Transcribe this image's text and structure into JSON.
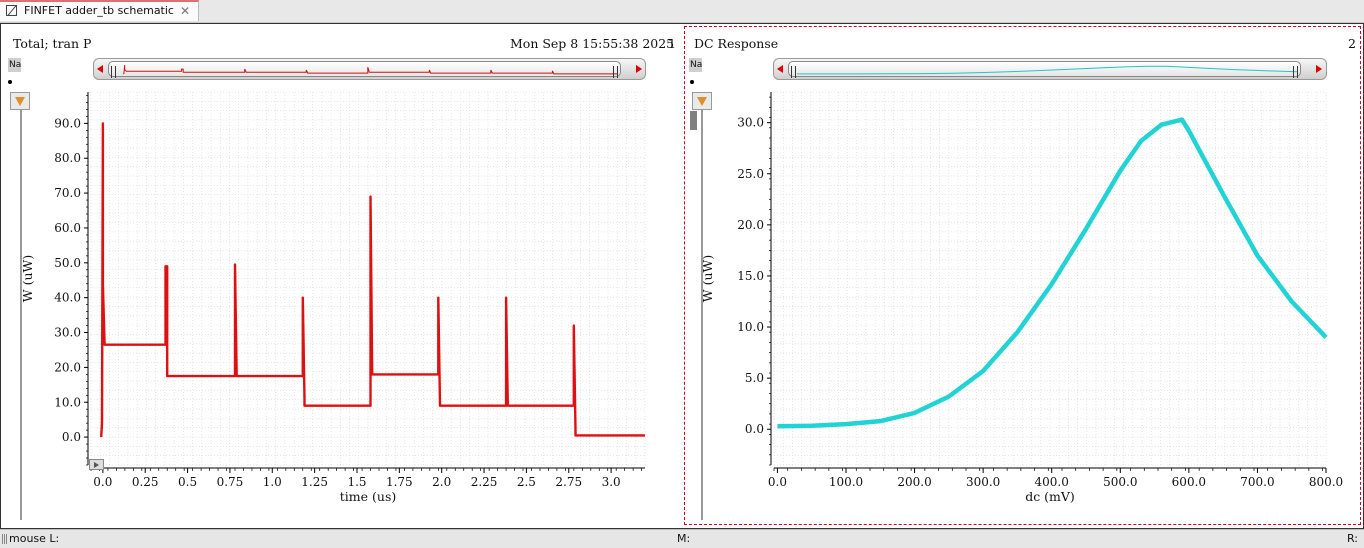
{
  "tab": {
    "label": "FINFET adder_tb schematic",
    "close": "✕"
  },
  "left_pane": {
    "title": "Total; tran P",
    "timestamp": "Mon Sep 8 15:55:38 2025",
    "index": "1",
    "name_stub": "Na",
    "trace_color": "#dd1111"
  },
  "right_pane": {
    "title": "DC Response",
    "index": "2",
    "name_stub": "Na",
    "trace_color": "#22d3d6",
    "selected_border_color": "#cc0022"
  },
  "status": {
    "mouse_l": "mouse L:",
    "m": "M:",
    "r": "R:"
  },
  "chart_data": [
    {
      "type": "line",
      "xlabel": "time (us)",
      "ylabel": "W (uW)",
      "xlim": [
        -0.07,
        3.2
      ],
      "ylim": [
        -8,
        99
      ],
      "x_ticks": [
        "0.0",
        "0.25",
        "0.5",
        "0.75",
        "1.0",
        "1.25",
        "1.5",
        "1.75",
        "2.0",
        "2.25",
        "2.5",
        "2.75",
        "3.0"
      ],
      "y_ticks": [
        "0.0",
        "10.0",
        "20.0",
        "30.0",
        "40.0",
        "50.0",
        "60.0",
        "70.0",
        "80.0",
        "90.0"
      ],
      "grid": true,
      "series": [
        {
          "color": "#dd1111",
          "x": [
            -0.01,
            -0.005,
            0.0,
            0.0,
            0.01,
            0.01,
            0.37,
            0.37,
            0.38,
            0.38,
            0.78,
            0.78,
            0.79,
            0.79,
            1.18,
            1.18,
            1.19,
            1.19,
            1.58,
            1.58,
            1.59,
            1.59,
            1.98,
            1.98,
            1.99,
            1.99,
            2.38,
            2.38,
            2.39,
            2.39,
            2.78,
            2.78,
            2.79,
            2.79,
            3.2
          ],
          "y": [
            0.0,
            4,
            90,
            44,
            26.5,
            26.5,
            26.5,
            49,
            49,
            17.5,
            17.5,
            49.5,
            17.5,
            17.5,
            17.5,
            40,
            11,
            9,
            9,
            69,
            18,
            18,
            18,
            40,
            9,
            9,
            9,
            40,
            9,
            9,
            9,
            32,
            2,
            0.5,
            0.5
          ]
        }
      ]
    },
    {
      "type": "line",
      "xlabel": "dc (mV)",
      "ylabel": "W (uW)",
      "xlim": [
        -5,
        800
      ],
      "ylim": [
        -3.5,
        33
      ],
      "x_ticks": [
        "0.0",
        "100.0",
        "200.0",
        "300.0",
        "400.0",
        "500.0",
        "600.0",
        "700.0",
        "800.0"
      ],
      "y_ticks": [
        "0.0",
        "5.0",
        "10.0",
        "15.0",
        "20.0",
        "25.0",
        "30.0"
      ],
      "grid": true,
      "series": [
        {
          "color": "#22d3d6",
          "x": [
            0,
            50,
            100,
            150,
            200,
            250,
            300,
            350,
            400,
            450,
            500,
            530,
            560,
            590,
            600,
            650,
            700,
            750,
            800
          ],
          "y": [
            0.3,
            0.35,
            0.5,
            0.8,
            1.6,
            3.2,
            5.7,
            9.5,
            14.2,
            19.6,
            25.3,
            28.2,
            29.8,
            30.3,
            29.2,
            23.0,
            17.0,
            12.5,
            9.0
          ]
        }
      ]
    }
  ]
}
